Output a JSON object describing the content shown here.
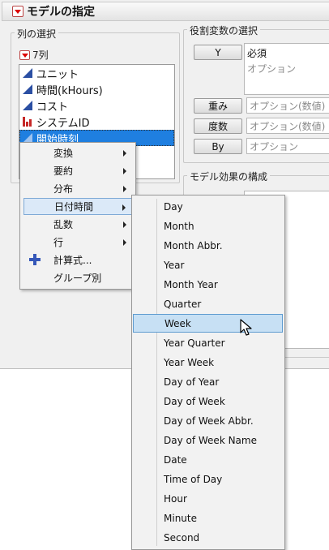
{
  "title": "モデルの指定",
  "column_selection": {
    "legend": "列の選択",
    "count_label": "7列",
    "columns": [
      {
        "label": "ユニット",
        "type": "continuous"
      },
      {
        "label": "時間(kHours)",
        "type": "continuous"
      },
      {
        "label": "コスト",
        "type": "continuous"
      },
      {
        "label": "システムID",
        "type": "nominal"
      },
      {
        "label": "開始時刻",
        "type": "continuous",
        "selected": true
      }
    ]
  },
  "role_selection": {
    "legend": "役割変数の選択",
    "y_button": "Y",
    "y_required": "必須",
    "y_optional": "オプション",
    "weight_button": "重み",
    "weight_field": "オプション(数値)",
    "freq_button": "度数",
    "freq_field": "オプション(数値)",
    "by_button": "By",
    "by_field": "オプション"
  },
  "model_effects": {
    "legend": "モデル効果の構成"
  },
  "context_menu": {
    "items": [
      {
        "label": "変換",
        "submenu": true
      },
      {
        "label": "要約",
        "submenu": true
      },
      {
        "label": "分布",
        "submenu": true
      },
      {
        "label": "日付時間",
        "submenu": true,
        "highlighted": true
      },
      {
        "label": "乱数",
        "submenu": true
      },
      {
        "label": "行",
        "submenu": true
      },
      {
        "label": "計算式...",
        "icon": "plus-icon"
      },
      {
        "label": "グループ別"
      }
    ]
  },
  "date_submenu": {
    "items": [
      "Day",
      "Month",
      "Month Abbr.",
      "Year",
      "Month Year",
      "Quarter",
      "Week",
      "Year Quarter",
      "Year Week",
      "Day of Year",
      "Day of Week",
      "Day of Week Abbr.",
      "Day of Week Name",
      "Date",
      "Time of Day",
      "Hour",
      "Minute",
      "Second"
    ],
    "highlighted": "Week"
  },
  "colors": {
    "selection": "#1f7fe0",
    "menu_highlight": "#c7e0f4",
    "continuous_icon": "#2b4fa3",
    "nominal_icon": "#c62828"
  }
}
